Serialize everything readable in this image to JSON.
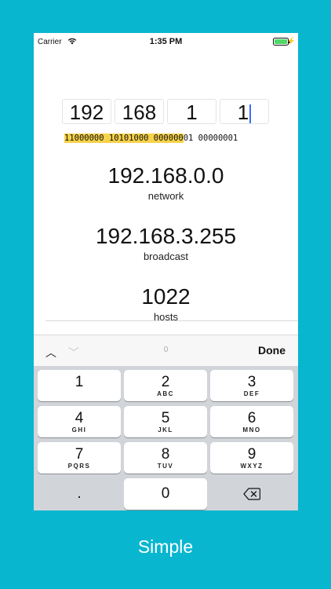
{
  "status": {
    "carrier": "Carrier",
    "time": "1:35 PM"
  },
  "ip": {
    "octets": [
      "192",
      "168",
      "1",
      "1"
    ]
  },
  "binary": {
    "highlighted": "11000000 10101000 000000",
    "rest": "01 00000001"
  },
  "results": [
    {
      "value": "192.168.0.0",
      "label": "network"
    },
    {
      "value": "192.168.3.255",
      "label": "broadcast"
    },
    {
      "value": "1022",
      "label": "hosts"
    }
  ],
  "accessory": {
    "center": "0",
    "done": "Done"
  },
  "keys": [
    {
      "digit": "1",
      "letters": ""
    },
    {
      "digit": "2",
      "letters": "ABC"
    },
    {
      "digit": "3",
      "letters": "DEF"
    },
    {
      "digit": "4",
      "letters": "GHI"
    },
    {
      "digit": "5",
      "letters": "JKL"
    },
    {
      "digit": "6",
      "letters": "MNO"
    },
    {
      "digit": "7",
      "letters": "PQRS"
    },
    {
      "digit": "8",
      "letters": "TUV"
    },
    {
      "digit": "9",
      "letters": "WXYZ"
    },
    {
      "digit": ".",
      "letters": ""
    },
    {
      "digit": "0",
      "letters": ""
    }
  ],
  "caption": "Simple"
}
